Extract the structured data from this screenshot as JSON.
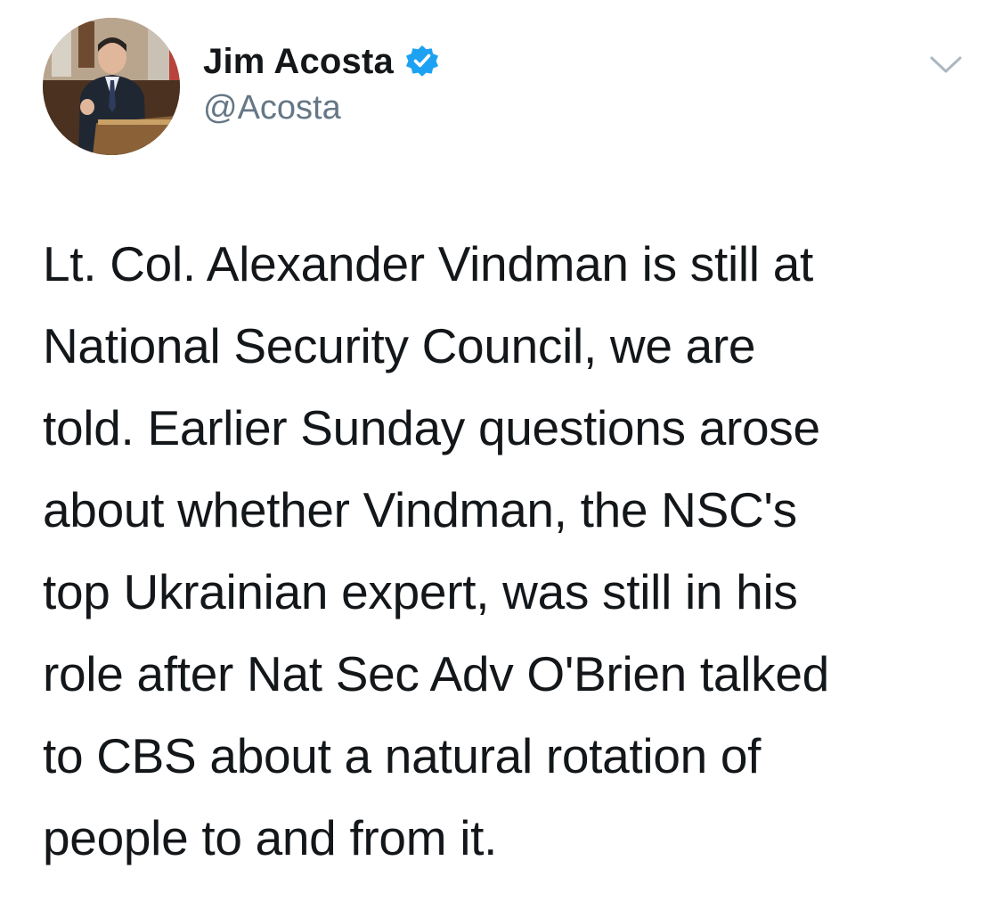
{
  "tweet": {
    "author": {
      "display_name": "Jim Acosta",
      "handle": "@Acosta",
      "verified": true,
      "avatar_icon": "profile-photo"
    },
    "caret_icon": "chevron-down-icon",
    "text_lines": [
      "Lt. Col. Alexander Vindman is still at",
      "National Security Council, we are",
      "told. Earlier Sunday questions arose",
      "about whether Vindman, the NSC's",
      "top Ukrainian expert, was still in his",
      "role after Nat Sec Adv O'Brien talked",
      "to CBS about a natural rotation of",
      "people to and from it."
    ]
  },
  "colors": {
    "text": "#14171a",
    "secondary_text": "#657786",
    "verified_blue": "#1da1f2",
    "caret": "#aab8c2",
    "background": "#ffffff"
  }
}
